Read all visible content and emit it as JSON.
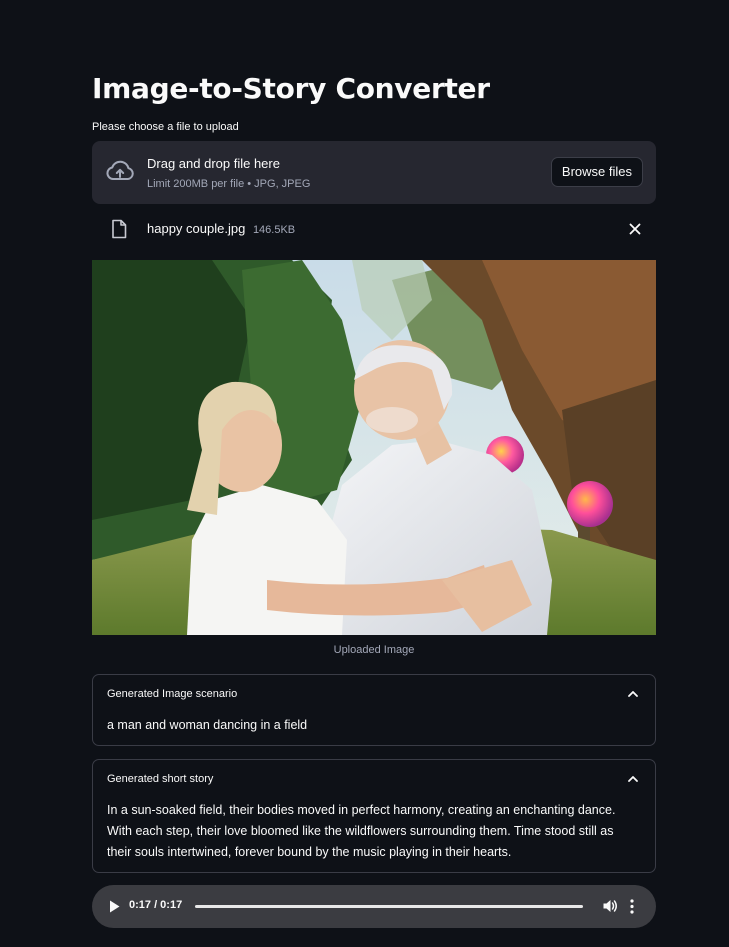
{
  "page": {
    "title": "Image-to-Story Converter"
  },
  "uploader": {
    "label": "Please choose a file to upload",
    "dropzone_title": "Drag and drop file here",
    "dropzone_limit": "Limit 200MB per file • JPG, JPEG",
    "browse_label": "Browse files",
    "icon": "cloud-upload-icon"
  },
  "uploaded_file": {
    "name": "happy couple.jpg",
    "size": "146.5KB",
    "icon": "file-icon",
    "remove_icon": "close-icon"
  },
  "image": {
    "caption": "Uploaded Image"
  },
  "scenario_expander": {
    "header": "Generated Image scenario",
    "body": "a man and woman dancing in a field",
    "expanded": true
  },
  "story_expander": {
    "header": "Generated short story",
    "body": "In a sun-soaked field, their bodies moved in perfect harmony, creating an enchanting dance. With each step, their love bloomed like the wildflowers surrounding them. Time stood still as their souls intertwined, forever bound by the music playing in their hearts.",
    "expanded": true
  },
  "audio_player": {
    "time": "0:17 / 0:17",
    "progress": 1.0,
    "icons": [
      "play-icon",
      "volume-icon",
      "more-vertical-icon"
    ]
  },
  "colors": {
    "background": "#0e1117",
    "panel": "#262730",
    "text": "#fafafa",
    "muted": "#a3a8b8",
    "border": "#3a3c46",
    "audio_bg": "#3b3c41"
  }
}
